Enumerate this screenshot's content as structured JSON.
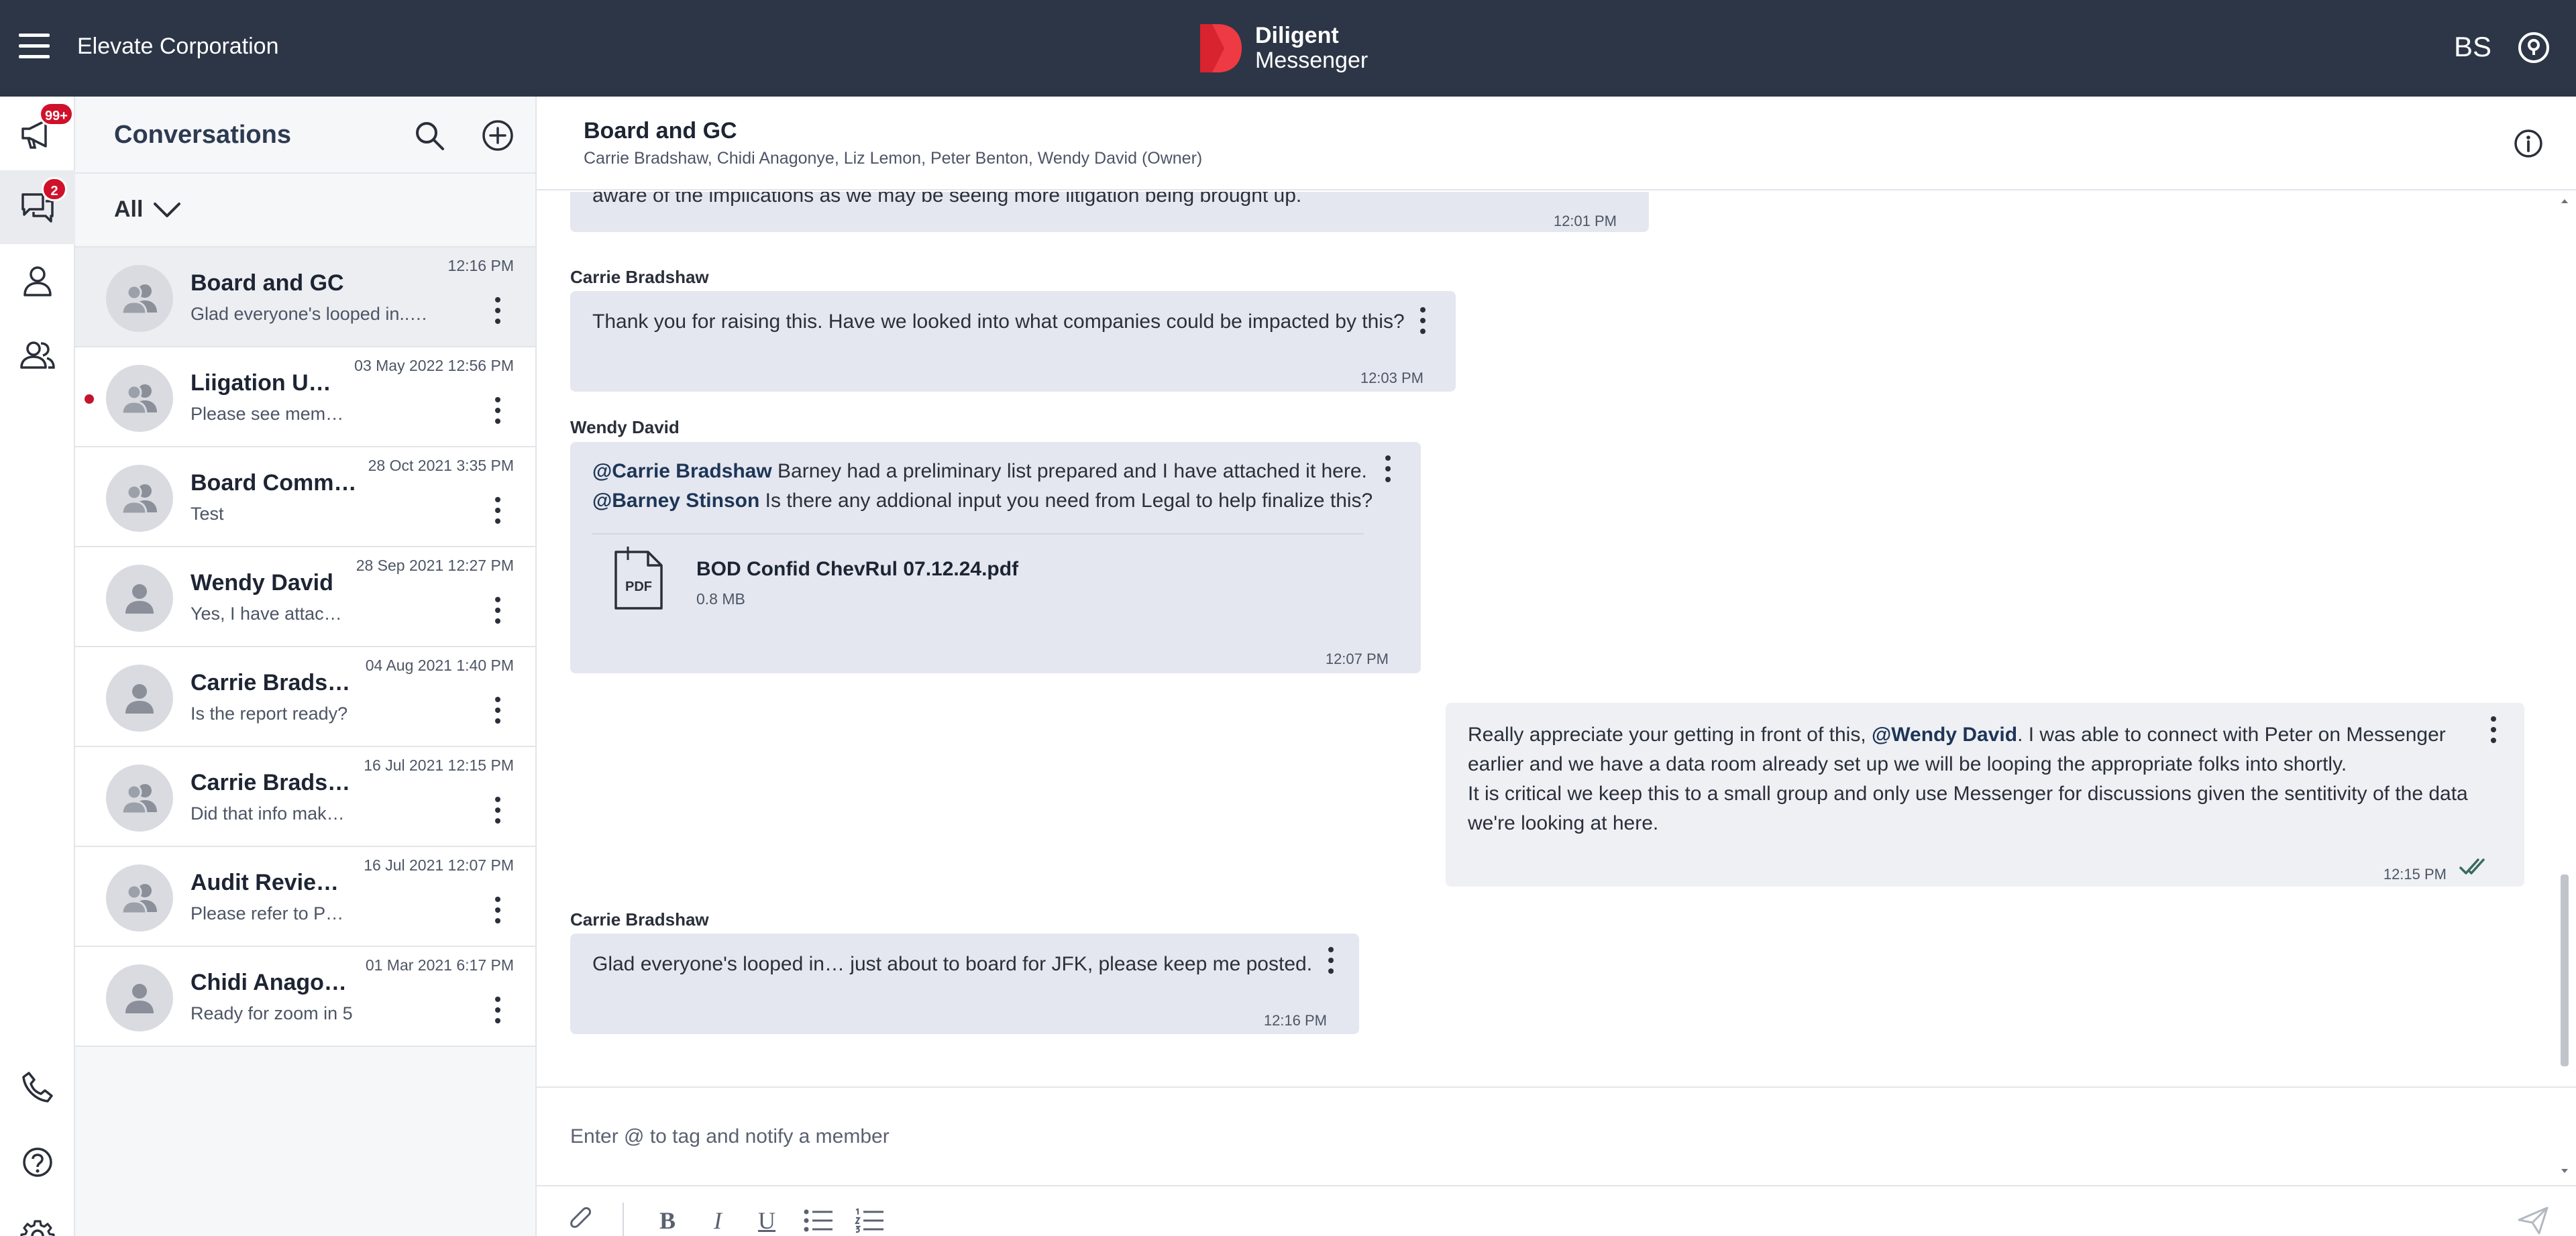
{
  "topbar": {
    "org_name": "Elevate Corporation",
    "brand_line1": "Diligent",
    "brand_line2": "Messenger",
    "user_initials": "BS",
    "colors": {
      "bar": "#2d3647",
      "logo_red": "#d9232e"
    }
  },
  "rail": {
    "announcements_badge": "99+",
    "chats_badge": "2",
    "icons": [
      "megaphone-icon",
      "chat-bubbles-icon",
      "person-icon",
      "people-icon",
      "phone-icon",
      "help-icon",
      "gear-icon"
    ]
  },
  "conversations": {
    "title": "Conversations",
    "filter_label": "All",
    "items": [
      {
        "name": "Board and GC",
        "preview": "Glad everyone's looped in...…",
        "time": "12:16 PM"
      },
      {
        "name": "Liigation U…",
        "preview": "Please see mem…",
        "time": "03 May 2022 12:56 PM"
      },
      {
        "name": "Board Comm…",
        "preview": "Test",
        "time": "28 Oct 2021 3:35 PM"
      },
      {
        "name": "Wendy David",
        "preview": "Yes, I have attac…",
        "time": "28 Sep 2021 12:27 PM"
      },
      {
        "name": "Carrie Brads…",
        "preview": "Is the report ready?",
        "time": "04 Aug 2021 1:40 PM"
      },
      {
        "name": "Carrie Brads…",
        "preview": "Did that info mak…",
        "time": "16 Jul 2021 12:15 PM"
      },
      {
        "name": "Audit Revie…",
        "preview": "Please refer to P…",
        "time": "16 Jul 2021 12:07 PM"
      },
      {
        "name": "Chidi Anago…",
        "preview": "Ready for zoom in 5",
        "time": "01 Mar 2021 6:17 PM"
      }
    ]
  },
  "chat": {
    "title": "Board and GC",
    "members": "Carrie Bradshaw, Chidi Anagonye, Liz Lemon, Peter Benton, Wendy David (Owner)",
    "messages": {
      "m0": {
        "text": "aware of the implications as we may be seeing more litigation being brought up.",
        "time": "12:01 PM"
      },
      "m1": {
        "sender": "Carrie Bradshaw",
        "text": "Thank you for raising this. Have we looked into what companies could be impacted by this?",
        "time": "12:03 PM"
      },
      "m2": {
        "sender": "Wendy David",
        "line1_mention": "@Carrie Bradshaw",
        "line1_text": " Barney had a preliminary list prepared and I have attached it here.",
        "line2_mention": "@Barney Stinson",
        "line2_text": " Is there any addional input you need from Legal to help finalize this?",
        "attachment_name": "BOD Confid ChevRul 07.12.24.pdf",
        "attachment_size": "0.8 MB",
        "attachment_type": "PDF",
        "time": "12:07 PM"
      },
      "m3": {
        "line1_a": "Really appreciate your getting in front of this, ",
        "line1_mention": "@Wendy David",
        "line1_b": ". I was able to connect with Peter on Messenger",
        "line2": "earlier and we have a data room already set up we will be looping the appropriate folks into shortly.",
        "line3": "It is critical we keep this to a small group and only use Messenger for discussions given the sentitivity of the data",
        "line4": "we're looking at here.",
        "time": "12:15 PM"
      },
      "m4": {
        "sender": "Carrie Bradshaw",
        "text": "Glad everyone's looped in… just about to board for JFK, please keep me posted.",
        "time": "12:16 PM"
      }
    },
    "composer_placeholder": "Enter @ to tag and notify a member",
    "format_buttons": {
      "bold": "B",
      "italic": "I",
      "underline": "U"
    }
  }
}
